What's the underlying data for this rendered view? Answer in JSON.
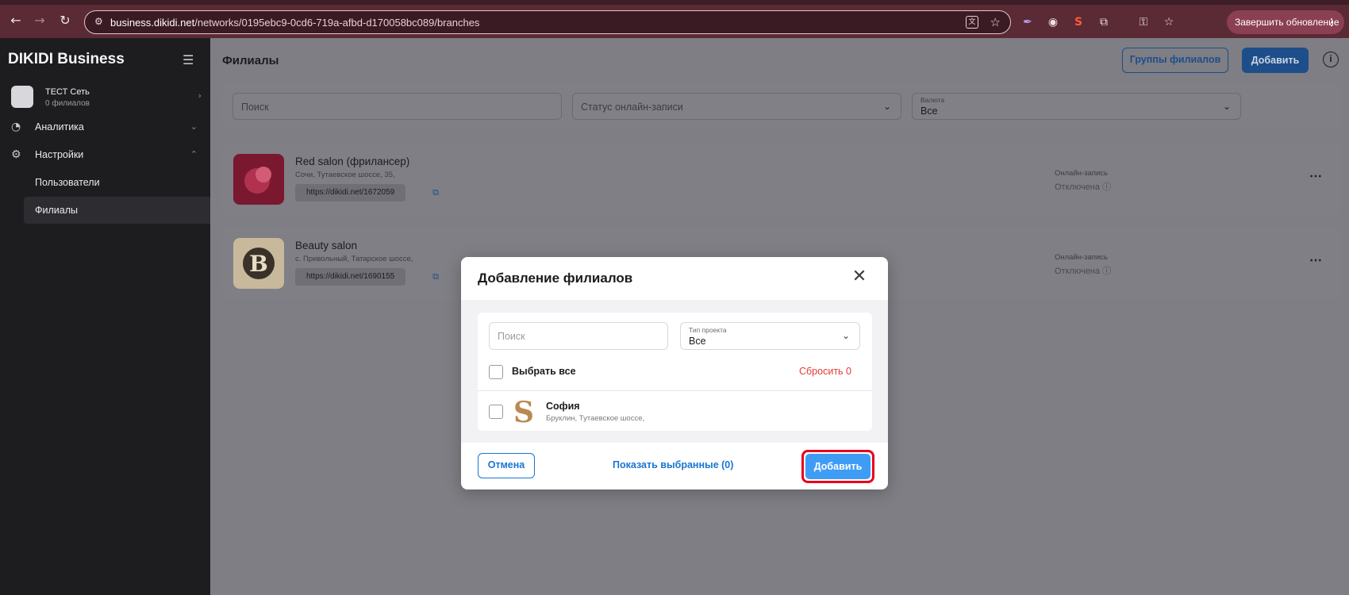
{
  "browser": {
    "url_domain": "business.dikidi.net",
    "url_path": "/networks/0195ebc9-0cd6-719a-afbd-d170058bc089/branches",
    "update_button": "Завершить обновление",
    "icons": [
      "back-icon",
      "forward-icon",
      "reload-icon",
      "site-settings-icon",
      "translate-icon",
      "star-icon",
      "feather-icon",
      "globe-icon",
      "extension-s-icon",
      "puzzle-icon",
      "key-icon",
      "bookmark-star-icon"
    ]
  },
  "sidebar": {
    "brand": "DIKIDI Business",
    "network": {
      "name": "ТЕСТ Сеть",
      "sub": "0 филиалов"
    },
    "items": [
      {
        "label": "Аналитика",
        "icon": "pie-chart-icon"
      },
      {
        "label": "Настройки",
        "icon": "gear-icon"
      }
    ],
    "subitems": [
      {
        "label": "Пользователи"
      },
      {
        "label": "Филиалы",
        "active": true
      }
    ]
  },
  "main": {
    "title": "Филиалы",
    "groups_button": "Группы филиалов",
    "add_button": "Добавить",
    "filters": {
      "search_placeholder": "Поиск",
      "status_placeholder": "Статус онлайн-записи",
      "currency_label": "Валюта",
      "currency_value": "Все"
    },
    "branches": [
      {
        "name": "Red salon (фрилансер)",
        "address": "Сочи, Тутаевское шоссе, 35,",
        "link": "https://dikidi.net/1672059",
        "online_label": "Онлайн-запись",
        "online_status": "Отключена",
        "logo_color": "#8a1a35"
      },
      {
        "name": "Beauty salon",
        "address": "с. Привольный, Татарское шоссе,",
        "link": "https://dikidi.net/1690155",
        "online_label": "Онлайн-запись",
        "online_status": "Отключена",
        "logo_color": "#d8c6a8"
      }
    ]
  },
  "modal": {
    "title": "Добавление филиалов",
    "search_placeholder": "Поиск",
    "type_label": "Тип проекта",
    "type_value": "Все",
    "select_all": "Выбрать все",
    "reset": "Сбросить 0",
    "items": [
      {
        "name": "София",
        "address": "Бруклин, Тутаевское шоссе,",
        "logo_letter": "S"
      }
    ],
    "cancel": "Отмена",
    "show_selected": "Показать выбранные (0)",
    "add": "Добавить"
  },
  "colors": {
    "primary": "#1976d2",
    "add_button": "#3f9cf5",
    "highlight": "#e8001c",
    "reset": "#e53935"
  }
}
